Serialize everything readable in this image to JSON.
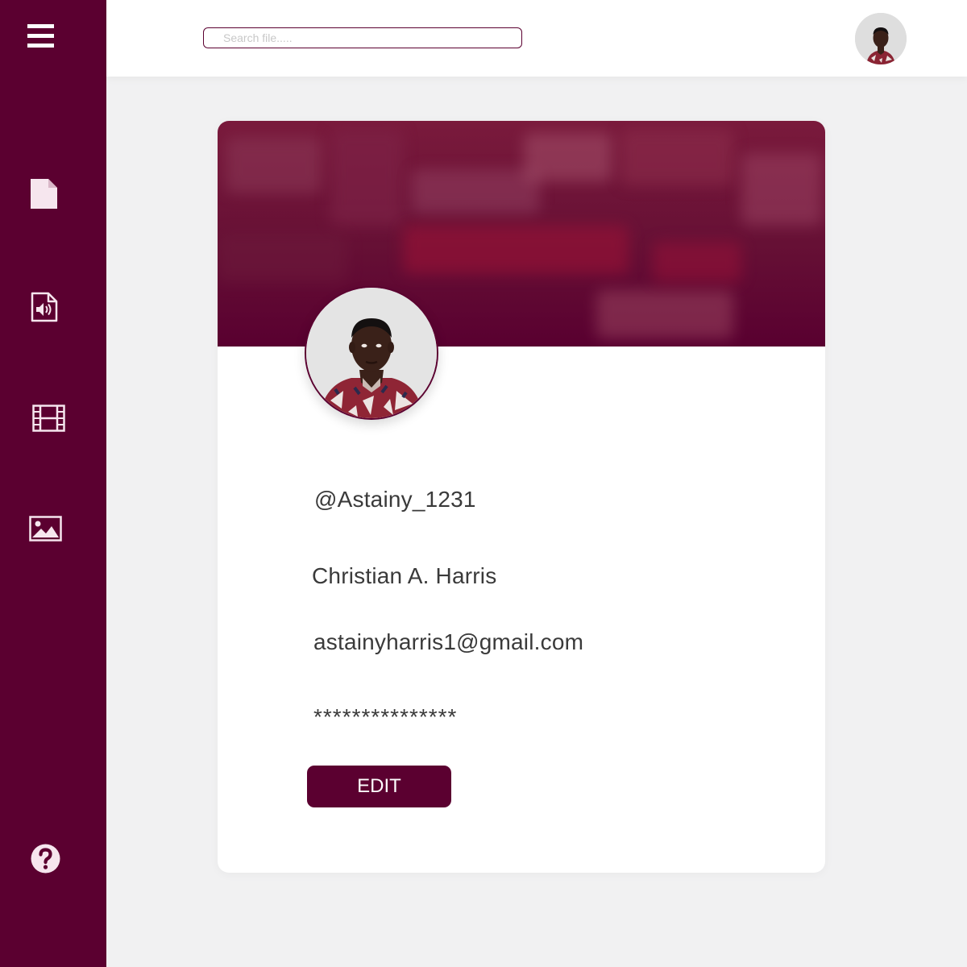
{
  "colors": {
    "brand": "#5b0030",
    "sidebar_icon": "#f6e6ee",
    "page_background": "#f1f1f2",
    "card_background": "#ffffff"
  },
  "sidebar": {
    "menu_icon": "hamburger-menu-icon",
    "items": [
      {
        "icon": "document-icon"
      },
      {
        "icon": "audio-file-icon"
      },
      {
        "icon": "film-icon"
      },
      {
        "icon": "image-icon"
      }
    ],
    "help_icon": "help-icon"
  },
  "search": {
    "placeholder": "Search file....."
  },
  "profile": {
    "username": "@Astainy_1231",
    "full_name": "Christian A. Harris",
    "email": "astainyharris1@gmail.com",
    "password_mask": "***************",
    "edit_label": "EDIT"
  }
}
